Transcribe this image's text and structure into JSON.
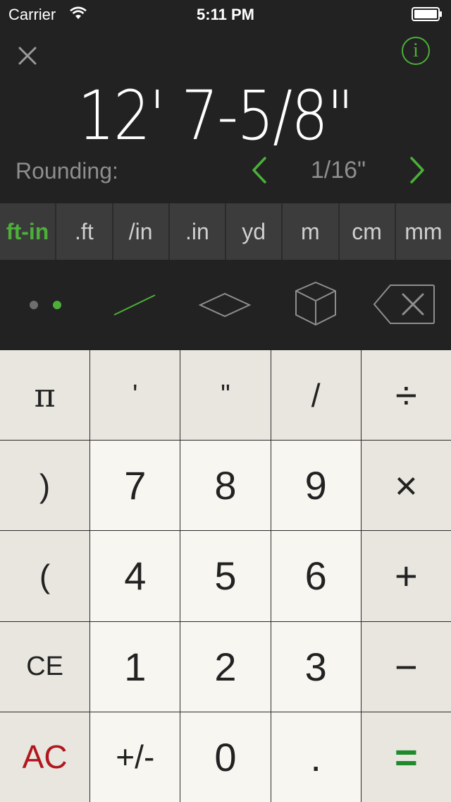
{
  "status": {
    "carrier": "Carrier",
    "time": "5:11 PM"
  },
  "header": {
    "close_icon": "close-icon",
    "info_icon": "info-icon",
    "info_label": "i"
  },
  "display": {
    "value": "12' 7-5/8\""
  },
  "rounding": {
    "label": "Rounding:",
    "value": "1/16\""
  },
  "unit_tabs": [
    {
      "label": "ft-in",
      "active": true
    },
    {
      "label": ".ft",
      "active": false
    },
    {
      "label": "/in",
      "active": false
    },
    {
      "label": ".in",
      "active": false
    },
    {
      "label": "yd",
      "active": false
    },
    {
      "label": "m",
      "active": false
    },
    {
      "label": "cm",
      "active": false
    },
    {
      "label": "mm",
      "active": false
    }
  ],
  "modes": [
    {
      "name": "point-mode",
      "icon": "dots-icon",
      "active": false
    },
    {
      "name": "length-mode",
      "icon": "line-icon",
      "active": true
    },
    {
      "name": "area-mode",
      "icon": "diamond-icon",
      "active": false
    },
    {
      "name": "volume-mode",
      "icon": "cube-icon",
      "active": false
    },
    {
      "name": "backspace",
      "icon": "backspace-icon",
      "active": false
    }
  ],
  "colors": {
    "accent_green": "#4caf3a",
    "ac_red": "#b0171d",
    "equals_green": "#1e8a2e",
    "background_dark": "#222222"
  },
  "keys": [
    {
      "label": "π",
      "name": "key-pi"
    },
    {
      "label": "'",
      "name": "key-feet"
    },
    {
      "label": "\"",
      "name": "key-inches"
    },
    {
      "label": "/",
      "name": "key-fraction"
    },
    {
      "label": "÷",
      "name": "key-divide"
    },
    {
      "label": ")",
      "name": "key-close-paren"
    },
    {
      "label": "7",
      "name": "key-7"
    },
    {
      "label": "8",
      "name": "key-8"
    },
    {
      "label": "9",
      "name": "key-9"
    },
    {
      "label": "×",
      "name": "key-multiply"
    },
    {
      "label": "(",
      "name": "key-open-paren"
    },
    {
      "label": "4",
      "name": "key-4"
    },
    {
      "label": "5",
      "name": "key-5"
    },
    {
      "label": "6",
      "name": "key-6"
    },
    {
      "label": "+",
      "name": "key-plus"
    },
    {
      "label": "CE",
      "name": "key-clear-entry"
    },
    {
      "label": "1",
      "name": "key-1"
    },
    {
      "label": "2",
      "name": "key-2"
    },
    {
      "label": "3",
      "name": "key-3"
    },
    {
      "label": "−",
      "name": "key-minus"
    },
    {
      "label": "AC",
      "name": "key-all-clear"
    },
    {
      "label": "+/-",
      "name": "key-sign"
    },
    {
      "label": "0",
      "name": "key-0"
    },
    {
      "label": ".",
      "name": "key-decimal"
    },
    {
      "label": "=",
      "name": "key-equals"
    }
  ]
}
